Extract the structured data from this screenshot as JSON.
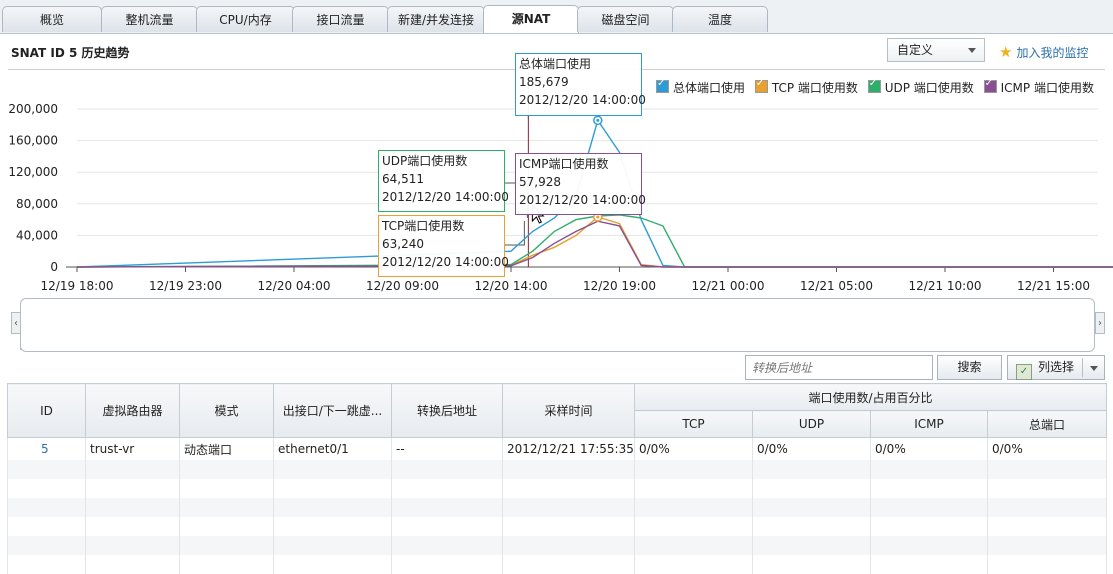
{
  "tabs": [
    {
      "label": "概览",
      "active": false
    },
    {
      "label": "整机流量",
      "active": false
    },
    {
      "label": "CPU/内存",
      "active": false
    },
    {
      "label": "接口流量",
      "active": false
    },
    {
      "label": "新建/并发连接",
      "active": false
    },
    {
      "label": "源NAT",
      "active": true
    },
    {
      "label": "磁盘空间",
      "active": false
    },
    {
      "label": "温度",
      "active": false
    }
  ],
  "header": {
    "title": "SNAT ID 5 历史趋势",
    "range_select": "自定义",
    "add_monitor_link": "加入我的监控"
  },
  "chart_data": {
    "type": "line",
    "legend_position": "top-right",
    "x_tick_labels": [
      "12/19 18:00",
      "12/19 23:00",
      "12/20 04:00",
      "12/20 09:00",
      "12/20 14:00",
      "12/20 19:00",
      "12/21 00:00",
      "12/21 05:00",
      "12/21 10:00",
      "12/21 15:00"
    ],
    "y_tick_labels": [
      "0",
      "40,000",
      "80,000",
      "120,000",
      "160,000",
      "200,000"
    ],
    "ylim": [
      0,
      200000
    ],
    "x_hours": [
      0,
      20,
      21,
      22,
      23,
      24,
      25,
      26,
      27,
      28,
      49,
      58,
      65
    ],
    "series": [
      {
        "name": "总体端口使用",
        "color": "#2d9bd6",
        "values": [
          0,
          20000,
          45000,
          62000,
          90000,
          185679,
          145000,
          60000,
          2000,
          0,
          0,
          800,
          800
        ]
      },
      {
        "name": "TCP 端口使用数",
        "color": "#e8a030",
        "values": [
          0,
          2000,
          15000,
          25000,
          40000,
          63240,
          55000,
          3000,
          0,
          0,
          0,
          0,
          0
        ]
      },
      {
        "name": "UDP 端口使用数",
        "color": "#2fae6a",
        "values": [
          0,
          3000,
          20000,
          45000,
          60000,
          64511,
          66000,
          62000,
          52000,
          0,
          0,
          0,
          0
        ]
      },
      {
        "name": "ICMP 端口使用数",
        "color": "#8a4e93",
        "values": [
          0,
          1500,
          12000,
          30000,
          45000,
          57928,
          52000,
          2000,
          0,
          0,
          0,
          1500,
          1500
        ]
      }
    ],
    "tooltips": [
      {
        "series": "总体端口使用",
        "value": "185,679",
        "time": "2012/12/20 14:00:00"
      },
      {
        "series": "UDP端口使用数",
        "value": "64,511",
        "time": "2012/12/20 14:00:00"
      },
      {
        "series": "ICMP端口使用数",
        "value": "57,928",
        "time": "2012/12/20 14:00:00"
      },
      {
        "series": "TCP端口使用数",
        "value": "63,240",
        "time": "2012/12/20 14:00:00"
      }
    ]
  },
  "toolbar": {
    "search_placeholder": "转换后地址",
    "search_button": "搜索",
    "column_select": "列选择"
  },
  "table": {
    "headers": [
      "ID",
      "虚拟路由器",
      "模式",
      "出接口/下一跳虚...",
      "转换后地址",
      "采样时间"
    ],
    "group_header": "端口使用数/占用百分比",
    "sub_headers": [
      "TCP",
      "UDP",
      "ICMP",
      "总端口"
    ],
    "rows": [
      [
        "5",
        "trust-vr",
        "动态端口",
        "ethernet0/1",
        "--",
        "2012/12/21 17:55:35",
        "0/0%",
        "0/0%",
        "0/0%",
        "0/0%"
      ]
    ]
  }
}
